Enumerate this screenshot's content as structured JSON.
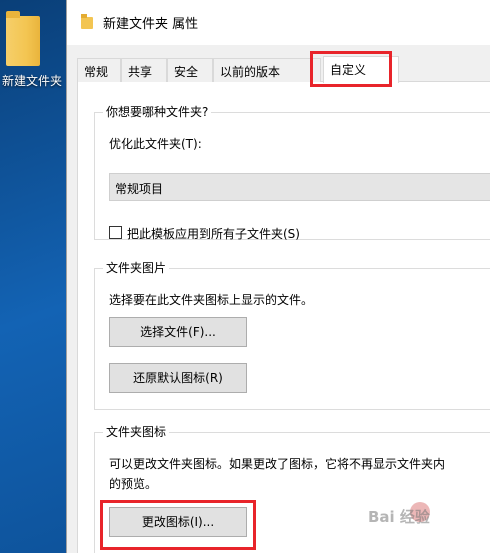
{
  "desktop": {
    "folder_label": "新建文件夹"
  },
  "window": {
    "title": "新建文件夹 属性"
  },
  "tabs": [
    {
      "label": "常规"
    },
    {
      "label": "共享"
    },
    {
      "label": "安全"
    },
    {
      "label": "以前的版本"
    },
    {
      "label": "自定义",
      "active": true
    }
  ],
  "section_type": {
    "title": "你想要哪种文件夹?",
    "optimize_label": "优化此文件夹(T):",
    "selected_option": "常规项目",
    "apply_template_label": "把此模板应用到所有子文件夹(S)",
    "apply_template_checked": false
  },
  "section_picture": {
    "title": "文件夹图片",
    "description": "选择要在此文件夹图标上显示的文件。",
    "choose_file_button": "选择文件(F)...",
    "restore_default_button": "还原默认图标(R)"
  },
  "section_icon": {
    "title": "文件夹图标",
    "description_line1": "可以更改文件夹图标。如果更改了图标，它将不再显示文件夹内",
    "description_line2": "的预览。",
    "change_icon_button": "更改图标(I)..."
  },
  "watermark": {
    "text": "Bai 经验"
  },
  "colors": {
    "highlight": "#e8242a",
    "window_bg": "#f0f0f0",
    "button_bg": "#e1e1e1"
  }
}
